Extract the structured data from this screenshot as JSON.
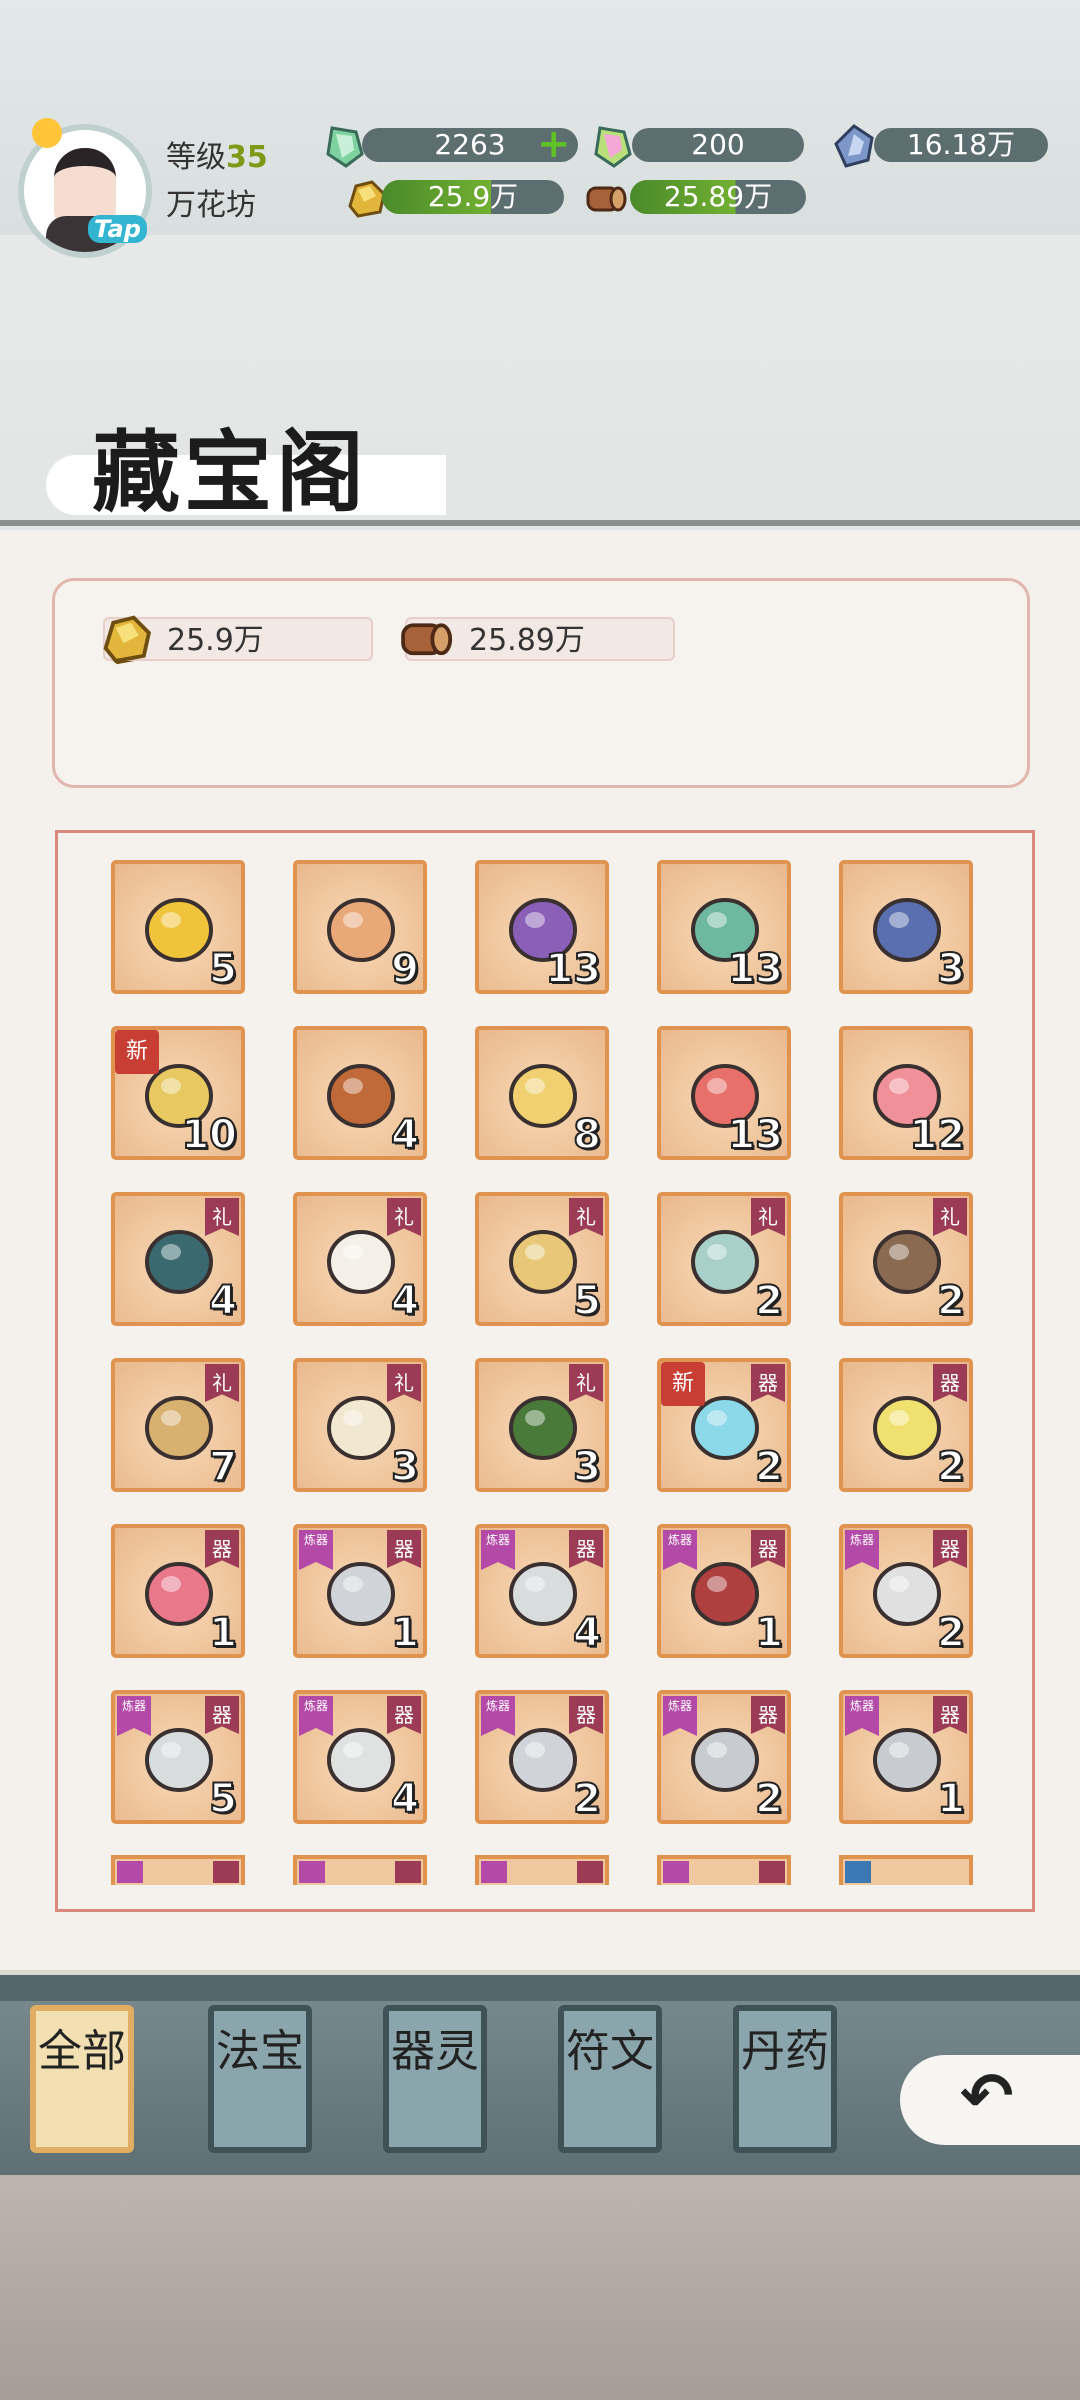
{
  "header": {
    "avatar_badge": "Tap",
    "level_label": "等级",
    "level_value": "35",
    "sect_name": "万花坊",
    "resources": {
      "jade": "2263",
      "rainbow_jade": "200",
      "spirit_crystal": "16.18万",
      "gold_ore": "25.9万",
      "wood": "25.89万"
    }
  },
  "page": {
    "title": "藏宝阁"
  },
  "storage": {
    "gold_ore": "25.9万",
    "wood": "25.89万"
  },
  "items": [
    {
      "icon": "gold-gift-box-icon",
      "count": "5"
    },
    {
      "icon": "ornate-chest-icon",
      "count": "9"
    },
    {
      "icon": "purple-chest-icon",
      "count": "13"
    },
    {
      "icon": "teal-chest-icon",
      "count": "13"
    },
    {
      "icon": "blue-chest-icon",
      "count": "3"
    },
    {
      "icon": "key-icon",
      "count": "10",
      "tag_left": "新"
    },
    {
      "icon": "treasure-pile-icon",
      "count": "4"
    },
    {
      "icon": "gold-egg-icon",
      "count": "8"
    },
    {
      "icon": "red-egg-icon",
      "count": "13"
    },
    {
      "icon": "pink-egg-icon",
      "count": "12"
    },
    {
      "icon": "lamp-icon",
      "count": "4",
      "tag_right": "礼"
    },
    {
      "icon": "vase-icon",
      "count": "4",
      "tag_right": "礼"
    },
    {
      "icon": "book-stack-icon",
      "count": "5",
      "tag_right": "礼"
    },
    {
      "icon": "rainbow-stone-icon",
      "count": "2",
      "tag_right": "礼"
    },
    {
      "icon": "soup-bowl-icon",
      "count": "2",
      "tag_right": "礼"
    },
    {
      "icon": "flute-icon",
      "count": "7",
      "tag_right": "礼"
    },
    {
      "icon": "scroll-icon",
      "count": "3",
      "tag_right": "礼"
    },
    {
      "icon": "bouquet-icon",
      "count": "3",
      "tag_right": "礼"
    },
    {
      "icon": "ice-crystal-icon",
      "count": "2",
      "tag_right": "器",
      "tag_left": "新"
    },
    {
      "icon": "gold-crystal-icon",
      "count": "2",
      "tag_right": "器"
    },
    {
      "icon": "red-crystal-icon",
      "count": "1",
      "tag_right": "器"
    },
    {
      "icon": "ring-icon",
      "count": "1",
      "tag_right": "器",
      "tag_refine": "炼器"
    },
    {
      "icon": "belt-icon",
      "count": "4",
      "tag_right": "器",
      "tag_refine": "炼器"
    },
    {
      "icon": "necklace-icon",
      "count": "1",
      "tag_right": "器",
      "tag_refine": "炼器"
    },
    {
      "icon": "hairpin-icon",
      "count": "2",
      "tag_right": "器",
      "tag_refine": "炼器"
    },
    {
      "icon": "boots-icon",
      "count": "5",
      "tag_right": "器",
      "tag_refine": "炼器"
    },
    {
      "icon": "robe-icon",
      "count": "4",
      "tag_right": "器",
      "tag_refine": "炼器"
    },
    {
      "icon": "token-icon",
      "count": "2",
      "tag_right": "器",
      "tag_refine": "炼器"
    },
    {
      "icon": "cauldron-icon",
      "count": "2",
      "tag_right": "器",
      "tag_refine": "炼器"
    },
    {
      "icon": "whisk-icon",
      "count": "1",
      "tag_right": "器",
      "tag_refine": "炼器"
    }
  ],
  "tabs": [
    {
      "label": "全部",
      "active": true
    },
    {
      "label": "法宝",
      "active": false
    },
    {
      "label": "器灵",
      "active": false
    },
    {
      "label": "符文",
      "active": false
    },
    {
      "label": "丹药",
      "active": false
    }
  ],
  "colors": {
    "item_border": "#e0934f",
    "tag_gift": "#9c3b55",
    "tag_refine": "#b44aa8",
    "tag_new": "#c83e35"
  }
}
